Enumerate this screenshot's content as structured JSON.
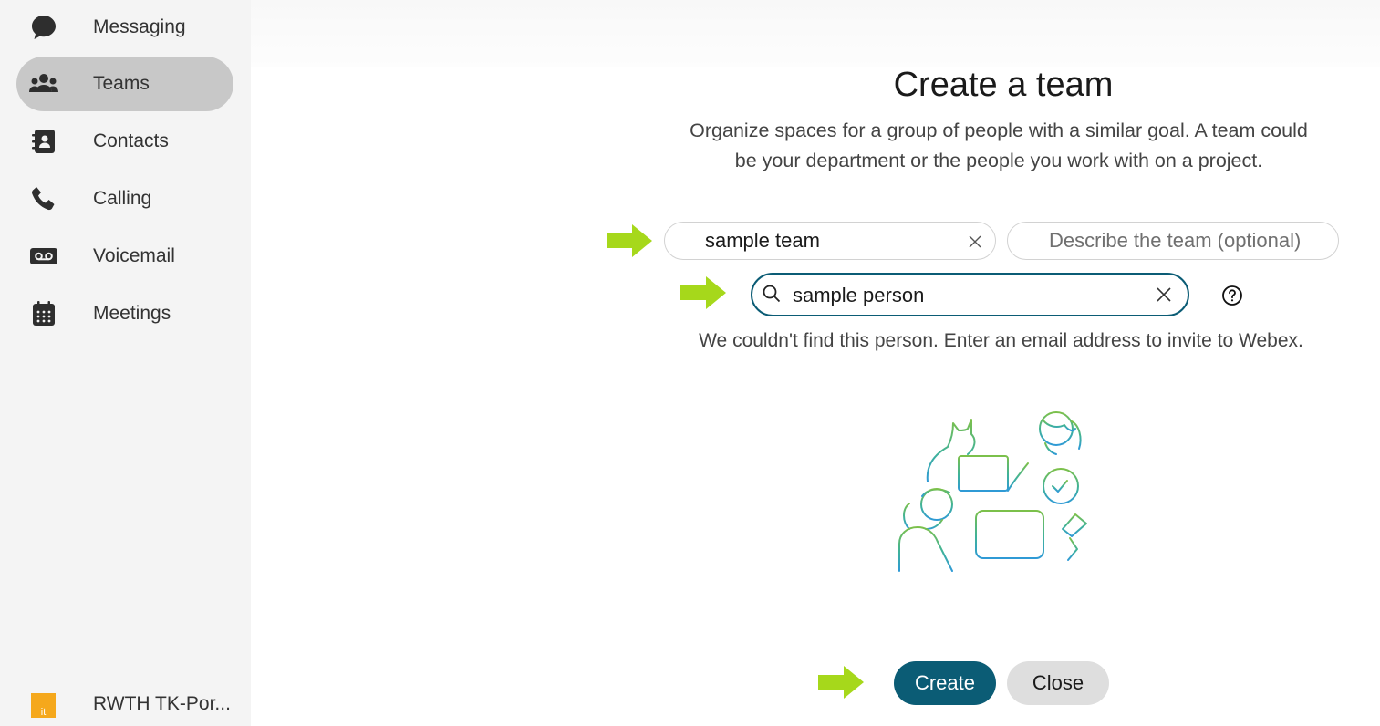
{
  "sidebar": {
    "items": [
      {
        "label": "Messaging",
        "icon": "message-bubble-icon",
        "active": false
      },
      {
        "label": "Teams",
        "icon": "people-group-icon",
        "active": true
      },
      {
        "label": "Contacts",
        "icon": "contact-book-icon",
        "active": false
      },
      {
        "label": "Calling",
        "icon": "phone-icon",
        "active": false
      },
      {
        "label": "Voicemail",
        "icon": "voicemail-icon",
        "active": false
      },
      {
        "label": "Meetings",
        "icon": "calendar-icon",
        "active": false
      }
    ],
    "org": {
      "label": "RWTH TK-Por...",
      "logo_text": "it"
    }
  },
  "dialog": {
    "title": "Create a team",
    "subtitle": "Organize spaces for a group of people with a similar goal. A team could be your department or the people you work with on a project.",
    "team_name_value": "sample team",
    "team_description_placeholder": "Describe the team (optional)",
    "person_search_value": "sample person",
    "error_message": "We couldn't find this person. Enter an email address to invite to Webex.",
    "create_label": "Create",
    "close_label": "Close"
  },
  "colors": {
    "accent": "#0b5c75",
    "sidebar_bg": "#f4f4f4",
    "active_item_bg": "#c8c8c8",
    "annotation_arrow": "#a6d81b",
    "close_button_bg": "#dedede",
    "org_logo": "#f5a81c"
  }
}
